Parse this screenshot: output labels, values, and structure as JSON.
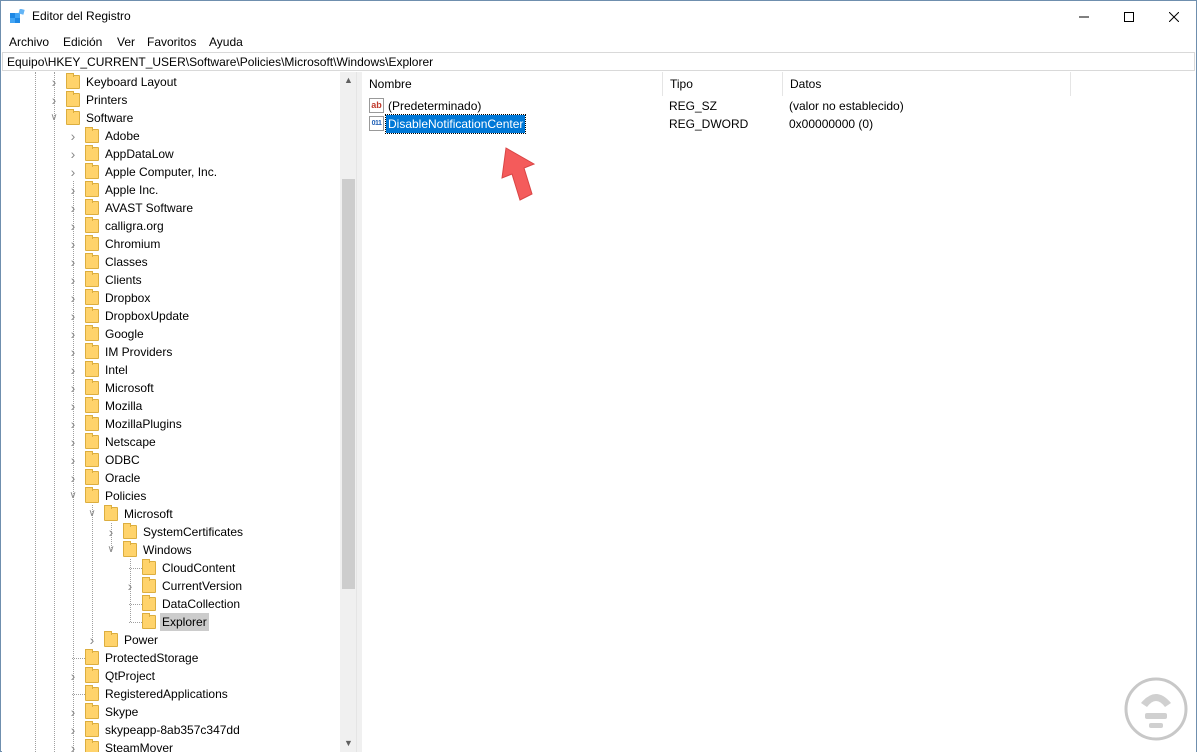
{
  "window": {
    "title": "Editor del Registro",
    "icon": "registry-editor-icon"
  },
  "menubar": {
    "items": [
      "Archivo",
      "Edición",
      "Ver",
      "Favoritos",
      "Ayuda"
    ]
  },
  "address": {
    "path": "Equipo\\HKEY_CURRENT_USER\\Software\\Policies\\Microsoft\\Windows\\Explorer"
  },
  "tree": {
    "items": [
      {
        "label": "Keyboard Layout",
        "level": 1,
        "expander": "collapsed"
      },
      {
        "label": "Printers",
        "level": 1,
        "expander": "collapsed"
      },
      {
        "label": "Software",
        "level": 1,
        "expander": "expanded"
      },
      {
        "label": "Adobe",
        "level": 2,
        "expander": "collapsed"
      },
      {
        "label": "AppDataLow",
        "level": 2,
        "expander": "collapsed"
      },
      {
        "label": "Apple Computer, Inc.",
        "level": 2,
        "expander": "collapsed"
      },
      {
        "label": "Apple Inc.",
        "level": 2,
        "expander": "collapsed"
      },
      {
        "label": "AVAST Software",
        "level": 2,
        "expander": "collapsed"
      },
      {
        "label": "calligra.org",
        "level": 2,
        "expander": "collapsed"
      },
      {
        "label": "Chromium",
        "level": 2,
        "expander": "collapsed"
      },
      {
        "label": "Classes",
        "level": 2,
        "expander": "collapsed"
      },
      {
        "label": "Clients",
        "level": 2,
        "expander": "collapsed"
      },
      {
        "label": "Dropbox",
        "level": 2,
        "expander": "collapsed"
      },
      {
        "label": "DropboxUpdate",
        "level": 2,
        "expander": "collapsed"
      },
      {
        "label": "Google",
        "level": 2,
        "expander": "collapsed"
      },
      {
        "label": "IM Providers",
        "level": 2,
        "expander": "collapsed"
      },
      {
        "label": "Intel",
        "level": 2,
        "expander": "collapsed"
      },
      {
        "label": "Microsoft",
        "level": 2,
        "expander": "collapsed"
      },
      {
        "label": "Mozilla",
        "level": 2,
        "expander": "collapsed"
      },
      {
        "label": "MozillaPlugins",
        "level": 2,
        "expander": "collapsed"
      },
      {
        "label": "Netscape",
        "level": 2,
        "expander": "collapsed"
      },
      {
        "label": "ODBC",
        "level": 2,
        "expander": "collapsed"
      },
      {
        "label": "Oracle",
        "level": 2,
        "expander": "collapsed"
      },
      {
        "label": "Policies",
        "level": 2,
        "expander": "expanded"
      },
      {
        "label": "Microsoft",
        "level": 3,
        "expander": "expanded"
      },
      {
        "label": "SystemCertificates",
        "level": 4,
        "expander": "collapsed"
      },
      {
        "label": "Windows",
        "level": 4,
        "expander": "expanded"
      },
      {
        "label": "CloudContent",
        "level": 5,
        "expander": "none"
      },
      {
        "label": "CurrentVersion",
        "level": 5,
        "expander": "collapsed"
      },
      {
        "label": "DataCollection",
        "level": 5,
        "expander": "none"
      },
      {
        "label": "Explorer",
        "level": 5,
        "expander": "none",
        "selected": true
      },
      {
        "label": "Power",
        "level": 3,
        "expander": "collapsed"
      },
      {
        "label": "ProtectedStorage",
        "level": 2,
        "expander": "none"
      },
      {
        "label": "QtProject",
        "level": 2,
        "expander": "collapsed"
      },
      {
        "label": "RegisteredApplications",
        "level": 2,
        "expander": "none"
      },
      {
        "label": "Skype",
        "level": 2,
        "expander": "collapsed"
      },
      {
        "label": "skypeapp-8ab357c347dd",
        "level": 2,
        "expander": "collapsed"
      },
      {
        "label": "SteamMover",
        "level": 2,
        "expander": "collapsed"
      }
    ]
  },
  "list": {
    "columns": [
      "Nombre",
      "Tipo",
      "Datos"
    ],
    "rows": [
      {
        "icon": "string-value-icon",
        "icon_text": "ab",
        "name": "(Predeterminado)",
        "type": "REG_SZ",
        "data": "(valor no establecido)",
        "selected": false
      },
      {
        "icon": "dword-value-icon",
        "icon_text": "011",
        "name": "DisableNotificationCenter",
        "type": "REG_DWORD",
        "data": "0x00000000 (0)",
        "selected": true
      }
    ]
  },
  "colors": {
    "selection": "#0078d7",
    "folder": "#ffd36b",
    "arrow": "#f45b5b"
  }
}
